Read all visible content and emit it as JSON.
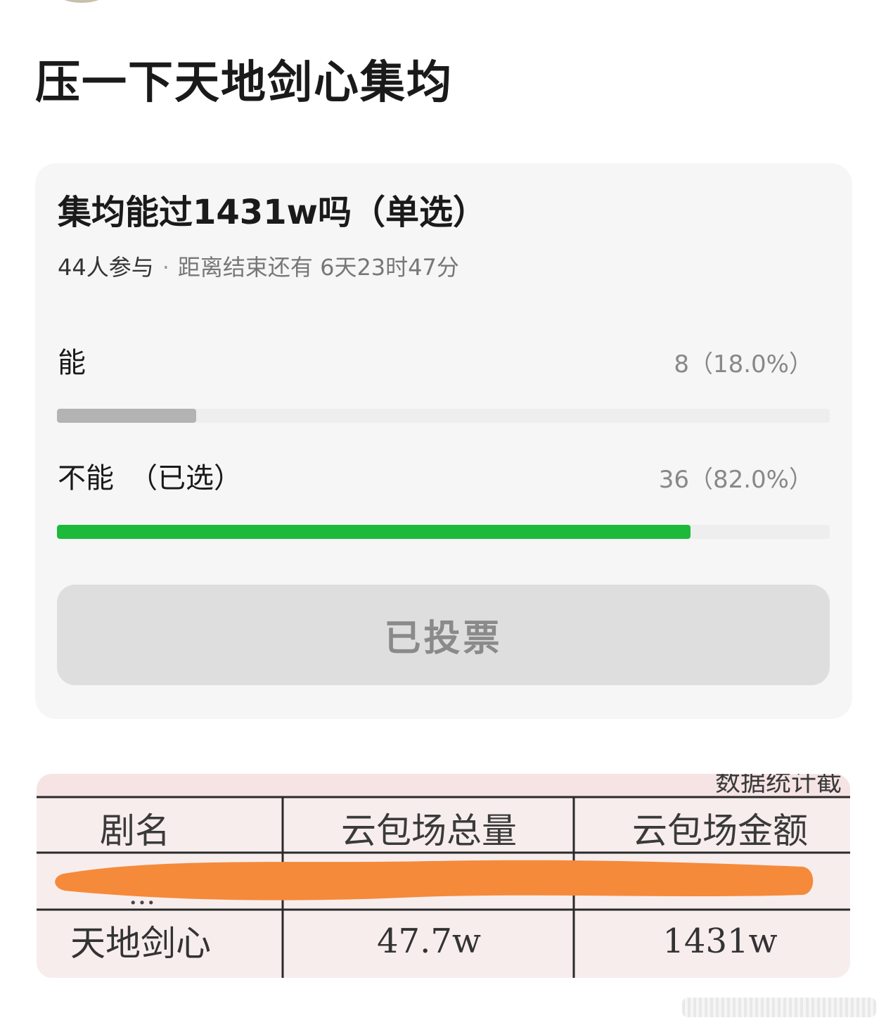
{
  "post": {
    "title": "压一下天地剑心集均"
  },
  "poll": {
    "question": "集均能过1431w吗（单选）",
    "participants": "44人参与",
    "deadline": "距离结束还有 6天23时47分",
    "options": [
      {
        "label": "能",
        "selected_tag": "",
        "result": "8（18.0%）",
        "percent": 18.0,
        "bar_color": "#b3b3b3"
      },
      {
        "label": "不能",
        "selected_tag": "（已选）",
        "result": "36（82.0%）",
        "percent": 82.0,
        "bar_color": "#1cb93a"
      }
    ],
    "vote_button_label": "已投票"
  },
  "image": {
    "caption_partial": "数据统计截",
    "table": {
      "headers": [
        "剧名",
        "云包场总量",
        "云包场金额"
      ],
      "redacted_row_partial": "...",
      "row": [
        "天地剑心",
        "47.7w",
        "1431w"
      ]
    },
    "redaction_color": "#f58a3b"
  }
}
